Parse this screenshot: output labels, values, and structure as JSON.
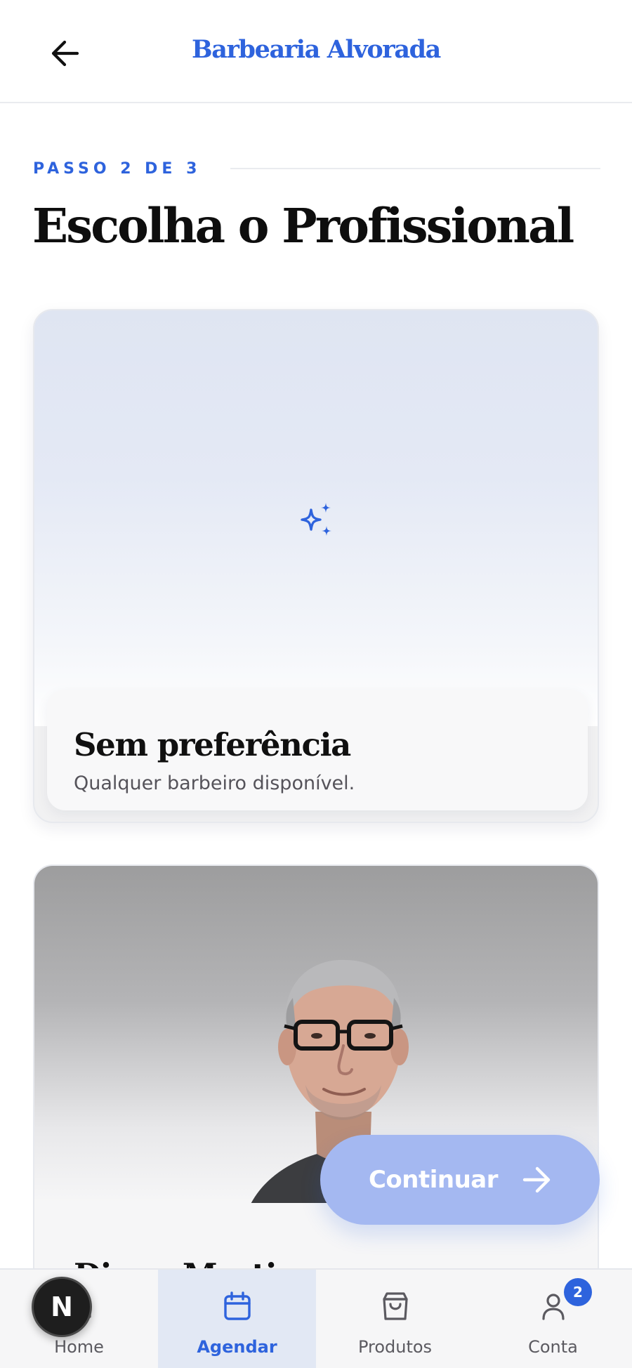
{
  "header": {
    "title": "Barbearia Alvorada",
    "back_icon": "arrow-left-icon"
  },
  "step": {
    "label": "PASSO 2 DE 3",
    "title": "Escolha o Profissional"
  },
  "professionals": [
    {
      "name": "Sem preferência",
      "description": "Qualquer barbeiro disponível.",
      "icon": "sparkles-icon"
    },
    {
      "name": "Diogo Martins"
    }
  ],
  "continue_button": {
    "label": "Continuar",
    "icon": "arrow-right-icon"
  },
  "bottom_nav": {
    "items": [
      {
        "label": "Home",
        "icon": "home-icon"
      },
      {
        "label": "Agendar",
        "icon": "calendar-icon"
      },
      {
        "label": "Produtos",
        "icon": "shopping-bag-icon"
      },
      {
        "label": "Conta",
        "icon": "user-icon",
        "badge": "2"
      }
    ],
    "active": "Agendar"
  },
  "dev_indicator": {
    "letter": "N"
  },
  "colors": {
    "accent": "#2e63dd",
    "continue_bg": "#a4b8f1",
    "nav_active_bg": "#e2e8f4"
  }
}
